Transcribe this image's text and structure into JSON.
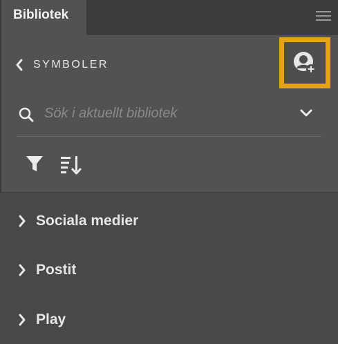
{
  "tabbar": {
    "active_tab": "Bibliotek",
    "menu_icon": "hamburger-menu-icon"
  },
  "header": {
    "back_label": "SYMBOLER",
    "back_icon": "chevron-left-icon",
    "add_user_icon": "add-user-icon"
  },
  "search": {
    "placeholder": "Sök i aktuellt bibliotek",
    "value": "",
    "search_icon": "search-icon",
    "dropdown_icon": "chevron-down-icon"
  },
  "toolbar": {
    "filter_icon": "filter-icon",
    "sort_icon": "sort-icon"
  },
  "list": {
    "items": [
      {
        "label": "Sociala medier"
      },
      {
        "label": "Postit"
      },
      {
        "label": "Play"
      }
    ]
  },
  "colors": {
    "highlight": "#e6a21a",
    "panel_bg": "#525252",
    "list_bg": "#484848",
    "tabbar_bg": "#3c3c3c"
  }
}
